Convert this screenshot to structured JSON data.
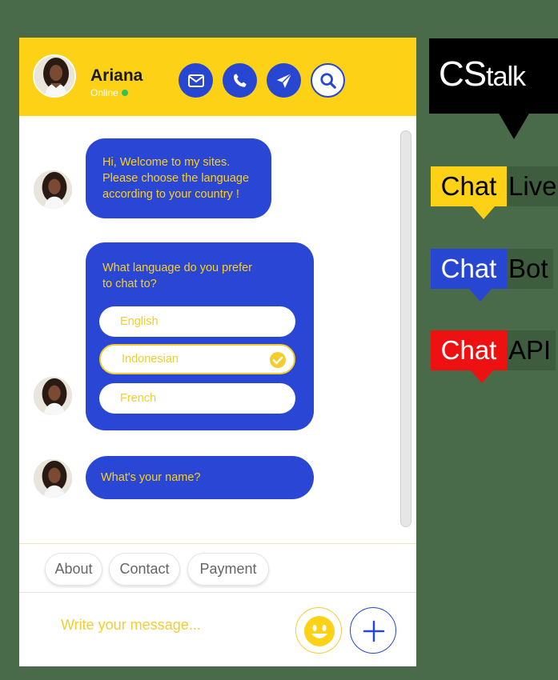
{
  "header": {
    "name": "Ariana",
    "status": "Online"
  },
  "messages": [
    {
      "text": "Hi, Welcome to my sites.\nPlease choose the language\naccording to your country !"
    },
    {
      "text": "What language do you prefer\nto chat to?",
      "options": [
        "English",
        "Indonesian",
        "French"
      ],
      "selected": "Indonesian"
    },
    {
      "text": "What's your name?"
    }
  ],
  "quick_replies": [
    "About",
    "Contact",
    "Payment"
  ],
  "composer": {
    "placeholder": "Write your message..."
  },
  "brand": {
    "logo_cs": "CS",
    "logo_talk": "talk",
    "tags": [
      {
        "chip": "Chat",
        "rest": "Live",
        "color": "#fdd116",
        "text_color": "#000000"
      },
      {
        "chip": "Chat",
        "rest": "Bot",
        "color": "#2747d3",
        "text_color": "#ffffff"
      },
      {
        "chip": "Chat",
        "rest": "API",
        "color": "#ee1111",
        "text_color": "#ffffff"
      }
    ]
  },
  "colors": {
    "yellow": "#fdd116",
    "blue": "#2747d3"
  }
}
